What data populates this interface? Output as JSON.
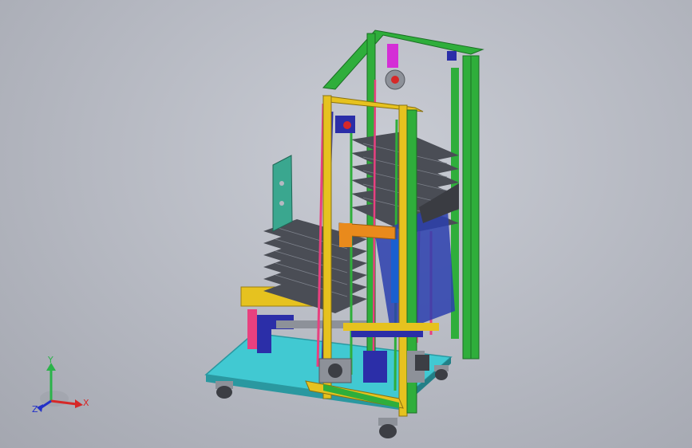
{
  "viewport": {
    "background_top": "#c9ccd4",
    "background_bottom": "#a4a7b0"
  },
  "model": {
    "colors": {
      "base_plate": "#41c9d2",
      "base_edge": "#2a98a0",
      "frame_green": "#2fae3b",
      "frame_green_dark": "#1b6e24",
      "frame_yellow": "#e6c21f",
      "tray": "#4a4d55",
      "tray_grid": "#7c808a",
      "rod_pink": "#e8407f",
      "rod_blue": "#2b2ea8",
      "block_orange": "#e98a1c",
      "panel_teal": "#3aa78f",
      "motor_grey": "#8d9199",
      "wheel": "#3c3e44",
      "accent_magenta": "#d42ed6"
    }
  },
  "triad": {
    "x_label": "X",
    "y_label": "Y",
    "z_label": "Z",
    "x_color": "#d62828",
    "y_color": "#2bb34a",
    "z_color": "#2230c8"
  }
}
